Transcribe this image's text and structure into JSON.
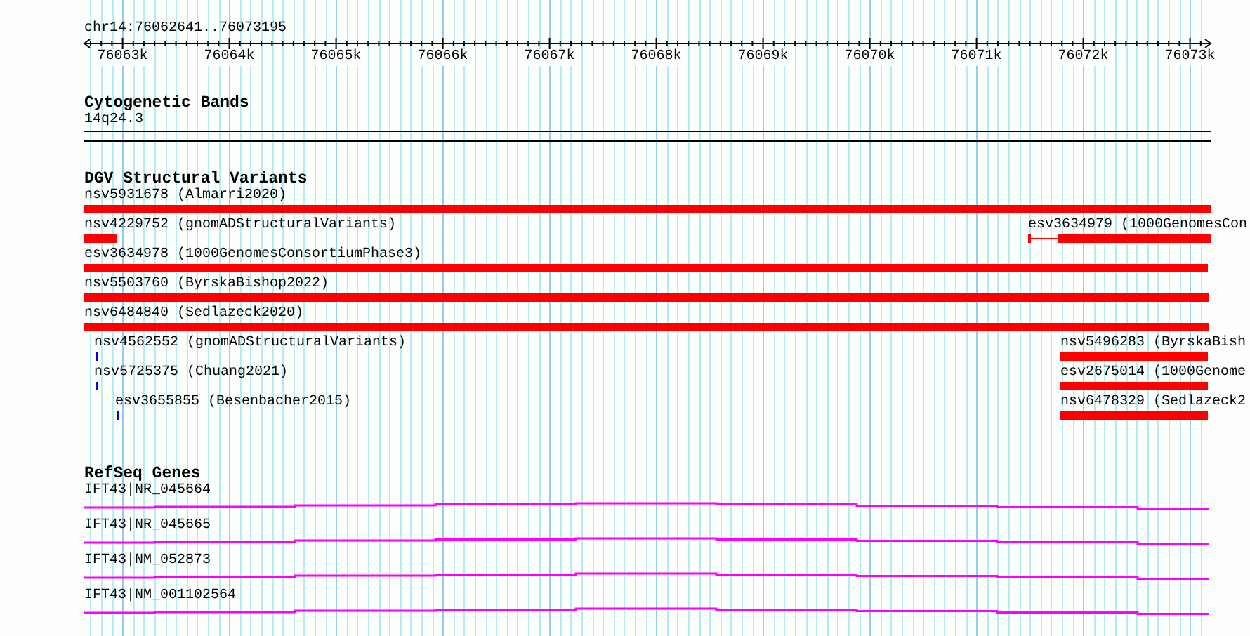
{
  "location": "chr14:76062641..76073195",
  "ruler": {
    "ticks": [
      "76063k",
      "76064k",
      "76065k",
      "76066k",
      "76067k",
      "76068k",
      "76069k",
      "76070k",
      "76071k",
      "76072k",
      "76073k"
    ]
  },
  "tracks": [
    {
      "kind": "bands",
      "title": "Cytogenetic Bands",
      "band": "14q24.3"
    },
    {
      "kind": "variants",
      "title": "DGV Structural Variants",
      "rows": [
        {
          "features": [
            {
              "kind": "bar",
              "label": "nsv5931678 (Almarri2020)",
              "color": "#ff0000"
            }
          ]
        },
        {
          "features": [
            {
              "kind": "bar",
              "label": "nsv4229752 (gnomADStructuralVariants)",
              "color": "#ff0000"
            },
            {
              "kind": "split",
              "label": "esv3634979 (1000GenomesCon",
              "color": "#ff0000"
            }
          ]
        },
        {
          "features": [
            {
              "kind": "bar",
              "label": "esv3634978 (1000GenomesConsortiumPhase3)",
              "color": "#ff0000"
            }
          ]
        },
        {
          "features": [
            {
              "kind": "bar",
              "label": "nsv5503760 (ByrskaBishop2022)",
              "color": "#ff0000"
            }
          ]
        },
        {
          "features": [
            {
              "kind": "bar",
              "label": "nsv6484840 (Sedlazeck2020)",
              "color": "#ff0000"
            }
          ]
        },
        {
          "features": [
            {
              "kind": "bar",
              "label": "nsv4562552 (gnomADStructuralVariants)",
              "color": "#0000ff"
            },
            {
              "kind": "bar",
              "label": "nsv5496283 (ByrskaBish",
              "color": "#ff0000"
            }
          ]
        },
        {
          "features": [
            {
              "kind": "bar",
              "label": "nsv5725375 (Chuang2021)",
              "color": "#0000ff"
            },
            {
              "kind": "bar",
              "label": "esv2675014 (1000Genome",
              "color": "#ff0000"
            }
          ]
        },
        {
          "features": [
            {
              "kind": "bar",
              "label": "esv3655855 (Besenbacher2015)",
              "color": "#0000ff"
            },
            {
              "kind": "bar",
              "label": "nsv6478329 (Sedlazeck2",
              "color": "#ff0000"
            }
          ]
        }
      ]
    },
    {
      "kind": "genes",
      "title": "RefSeq Genes",
      "genes": [
        {
          "label": "IFT43|NR_045664"
        },
        {
          "label": "IFT43|NR_045665"
        },
        {
          "label": "IFT43|NM_052873"
        },
        {
          "label": "IFT43|NM_001102564"
        }
      ]
    }
  ]
}
